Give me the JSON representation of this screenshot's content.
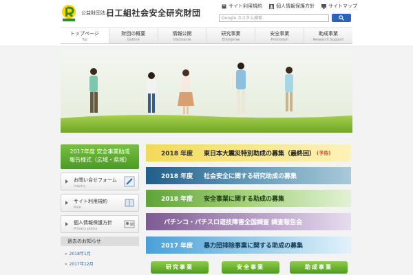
{
  "header": {
    "org_small": "公益財団法人",
    "org_main": "日工組社会安全研究財団",
    "top_links": [
      {
        "label": "サイト利用規約",
        "icon": "document-icon"
      },
      {
        "label": "個人情報保護方針",
        "icon": "person-icon"
      },
      {
        "label": "サイトマップ",
        "icon": "sitemap-icon"
      }
    ],
    "search_placeholder": "Google カスタム検索",
    "search_icon": "search-icon"
  },
  "nav": [
    {
      "jp": "トップページ",
      "en": "Top"
    },
    {
      "jp": "財団の概要",
      "en": "Outline"
    },
    {
      "jp": "情報公開",
      "en": "Disclosure"
    },
    {
      "jp": "研究事業",
      "en": "Enterprise"
    },
    {
      "jp": "安全事業",
      "en": "Promotion"
    },
    {
      "jp": "助成事業",
      "en": "Research Support"
    }
  ],
  "sidebar": {
    "green_button": [
      "2017年度 安全事業助成",
      "報告様式（広域・県域）"
    ],
    "buttons": [
      {
        "jp": "お問い合せフォーム",
        "en": "Inquiry",
        "icon": "pen-icon"
      },
      {
        "jp": "サイト利用規約",
        "en": "Rule",
        "icon": "book-icon"
      },
      {
        "jp": "個人情報保護方針",
        "en": "Privacy policy",
        "icon": "id-card-icon"
      }
    ],
    "news_title": "過去のお知らせ",
    "news": [
      "2018年1月",
      "2017年12月"
    ]
  },
  "banners": [
    {
      "year": "2018 年度",
      "title": "東日本大震災特別助成の募集（最終回）",
      "tag": "(予告)",
      "color_from": "#f6e27a",
      "color_to": "#fdf6c4"
    },
    {
      "year": "2018 年度",
      "title": "社会安全に関する研究助成の募集",
      "tag": "",
      "color_from": "#1f5f8b",
      "color_to": "#8fb7c9"
    },
    {
      "year": "2018 年度",
      "title": "安全事業に関する助成の募集",
      "tag": "",
      "color_from": "#6fb14a",
      "color_to": "#d6ecc4"
    },
    {
      "year": "",
      "title": "パチンコ・パチスロ遊技障害全国調査 調査報告会",
      "tag": "",
      "color_from": "#8a6a9e",
      "color_to": "#e0d2e8"
    },
    {
      "year": "2017 年度",
      "title": "暴力団排除事業に関する助成の募集",
      "tag": "",
      "color_from": "#5aa6d6",
      "color_to": "#d4ecf8"
    }
  ],
  "bottom_buttons": [
    "研究事業",
    "安全事業",
    "助成事業"
  ],
  "colors": {
    "accent_green": "#5aa72b",
    "accent_blue": "#2a63b8"
  }
}
